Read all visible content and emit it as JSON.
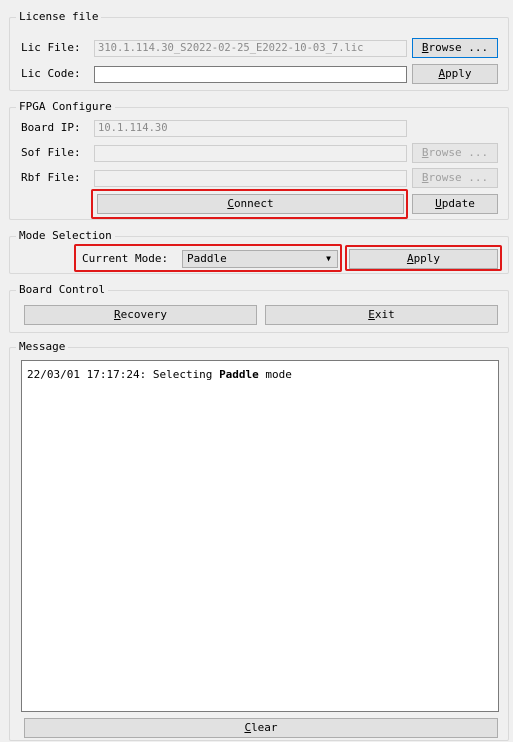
{
  "license": {
    "title": "License file",
    "lic_file_label": "Lic File:",
    "lic_file_value": "310.1.114.30_S2022-02-25_E2022-10-03_7.lic",
    "lic_code_label": "Lic Code:",
    "lic_code_value": "",
    "browse_label": "Browse ...",
    "apply_label": "Apply"
  },
  "fpga": {
    "title": "FPGA Configure",
    "board_ip_label": "Board IP:",
    "board_ip_value": "10.1.114.30",
    "sof_label": "Sof File:",
    "sof_value": "",
    "rbf_label": "Rbf File:",
    "rbf_value": "",
    "browse_sof_label": "Browse ...",
    "browse_rbf_label": "Browse ...",
    "connect_label": "Connect",
    "update_label": "Update"
  },
  "mode": {
    "title": "Mode Selection",
    "current_mode_label": "Current Mode:",
    "current_mode_value": "Paddle",
    "apply_label": "Apply"
  },
  "board": {
    "title": "Board Control",
    "recovery_label": "Recovery",
    "exit_label": "Exit"
  },
  "message": {
    "title": "Message",
    "log_prefix": "22/03/01 17:17:24: Selecting ",
    "log_mode": "Paddle",
    "log_suffix": " mode",
    "clear_label": "Clear"
  },
  "colors": {
    "highlight": "#e01818",
    "focus_border": "#0078d7"
  }
}
